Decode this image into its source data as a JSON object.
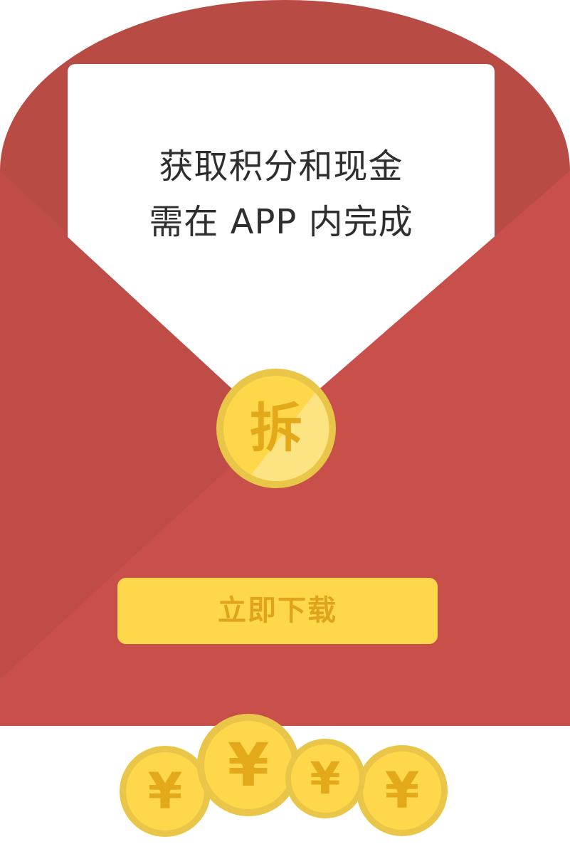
{
  "letter": {
    "line1": "获取积分和现金",
    "line2": "需在 APP 内完成"
  },
  "seal": {
    "label": "拆",
    "icon": "open-seal-coin-icon"
  },
  "download_button": {
    "label": "立即下载"
  },
  "coins": [
    {
      "symbol": "¥",
      "icon": "yuan-coin-icon"
    },
    {
      "symbol": "¥",
      "icon": "yuan-coin-icon"
    },
    {
      "symbol": "¥",
      "icon": "yuan-coin-icon"
    },
    {
      "symbol": "¥",
      "icon": "yuan-coin-icon"
    }
  ],
  "colors": {
    "envelope_dark": "#b94b45",
    "envelope_light": "#c9504a",
    "coin_yellow": "#fed84a",
    "coin_rim": "#e9c548",
    "glyph_gold": "#e3a91b",
    "letter_text": "#2e2e2e"
  }
}
